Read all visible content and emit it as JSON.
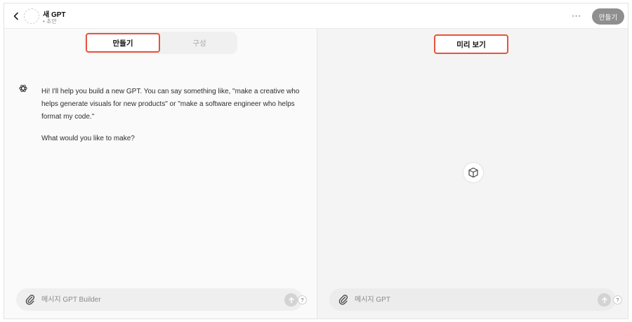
{
  "header": {
    "title": "새 GPT",
    "status": "• 초안",
    "more_label": "···",
    "create_button": "만들기"
  },
  "tabs": {
    "create": "만들기",
    "configure": "구성"
  },
  "preview": {
    "label": "미리 보기"
  },
  "chat": {
    "message_lines": [
      "Hi! I'll help you build a new GPT. You can say something like, \"make a creative who helps generate visuals for new products\" or \"make a software engineer who helps format my code.\"",
      "What would you like to make?"
    ]
  },
  "builder_input": {
    "placeholder": "메시지 GPT Builder",
    "help": "?"
  },
  "preview_input": {
    "placeholder": "메시지 GPT",
    "help": "?"
  },
  "icons": {
    "back": "chevron-left-icon",
    "avatar": "gpt-avatar-placeholder",
    "assistant": "openai-logo-icon",
    "attach": "paperclip-icon",
    "send": "arrow-up-icon",
    "cube": "cube-icon"
  },
  "colors": {
    "highlight_border": "#e8533c",
    "create_button_bg": "#8f8f8f"
  }
}
